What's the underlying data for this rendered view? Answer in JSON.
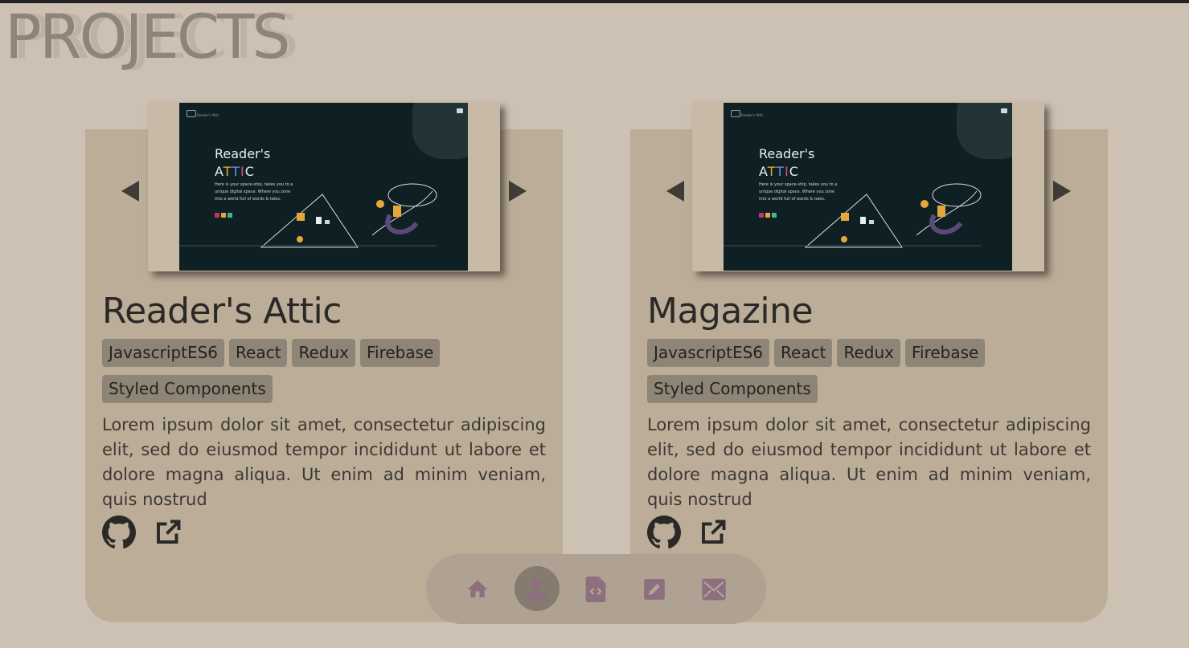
{
  "page": {
    "title": "PROJECTS"
  },
  "projects": [
    {
      "title": "Reader's Attic",
      "tags": [
        "JavascriptES6",
        "React",
        "Redux",
        "Firebase",
        "Styled Components"
      ],
      "description": "Lorem ipsum dolor sit amet, consectetur adipiscing elit, sed do eiusmod tempor incididunt ut labore et dolore magna aliqua. Ut enim ad minim veniam, quis nostrud",
      "preview": {
        "heading_line1": "Reader's",
        "heading_line2_letters": [
          "A",
          "T",
          "T",
          "I",
          "C"
        ],
        "blurb": "Here is your space-ship, takes you to a unique digital space. Where you zone into a world full of words & tales.",
        "logo_text": "Reader's Attic"
      },
      "icons": {
        "prev": "triangle-left-icon",
        "next": "triangle-right-icon",
        "repo": "github-icon",
        "live": "external-link-icon"
      }
    },
    {
      "title": "Magazine",
      "tags": [
        "JavascriptES6",
        "React",
        "Redux",
        "Firebase",
        "Styled Components"
      ],
      "description": "Lorem ipsum dolor sit amet, consectetur adipiscing elit, sed do eiusmod tempor incididunt ut labore et dolore magna aliqua. Ut enim ad minim veniam, quis nostrud",
      "preview": {
        "heading_line1": "Reader's",
        "heading_line2_letters": [
          "A",
          "T",
          "T",
          "I",
          "C"
        ],
        "blurb": "Here is your space-ship, takes you to a unique digital space. Where you zone into a world full of words & tales.",
        "logo_text": "Reader's Attic"
      },
      "icons": {
        "prev": "triangle-left-icon",
        "next": "triangle-right-icon",
        "repo": "github-icon",
        "live": "external-link-icon"
      }
    }
  ],
  "dock": {
    "items": [
      {
        "icon": "home-icon",
        "active": false
      },
      {
        "icon": "user-icon",
        "active": true
      },
      {
        "icon": "code-file-icon",
        "active": false
      },
      {
        "icon": "edit-icon",
        "active": false
      },
      {
        "icon": "mail-icon",
        "active": false
      }
    ],
    "icon_color": "#8d6f80"
  },
  "colors": {
    "background": "#cdc1b3",
    "card": "#bcad99",
    "tag": "#8e8576",
    "accent": "#8d6f80"
  }
}
